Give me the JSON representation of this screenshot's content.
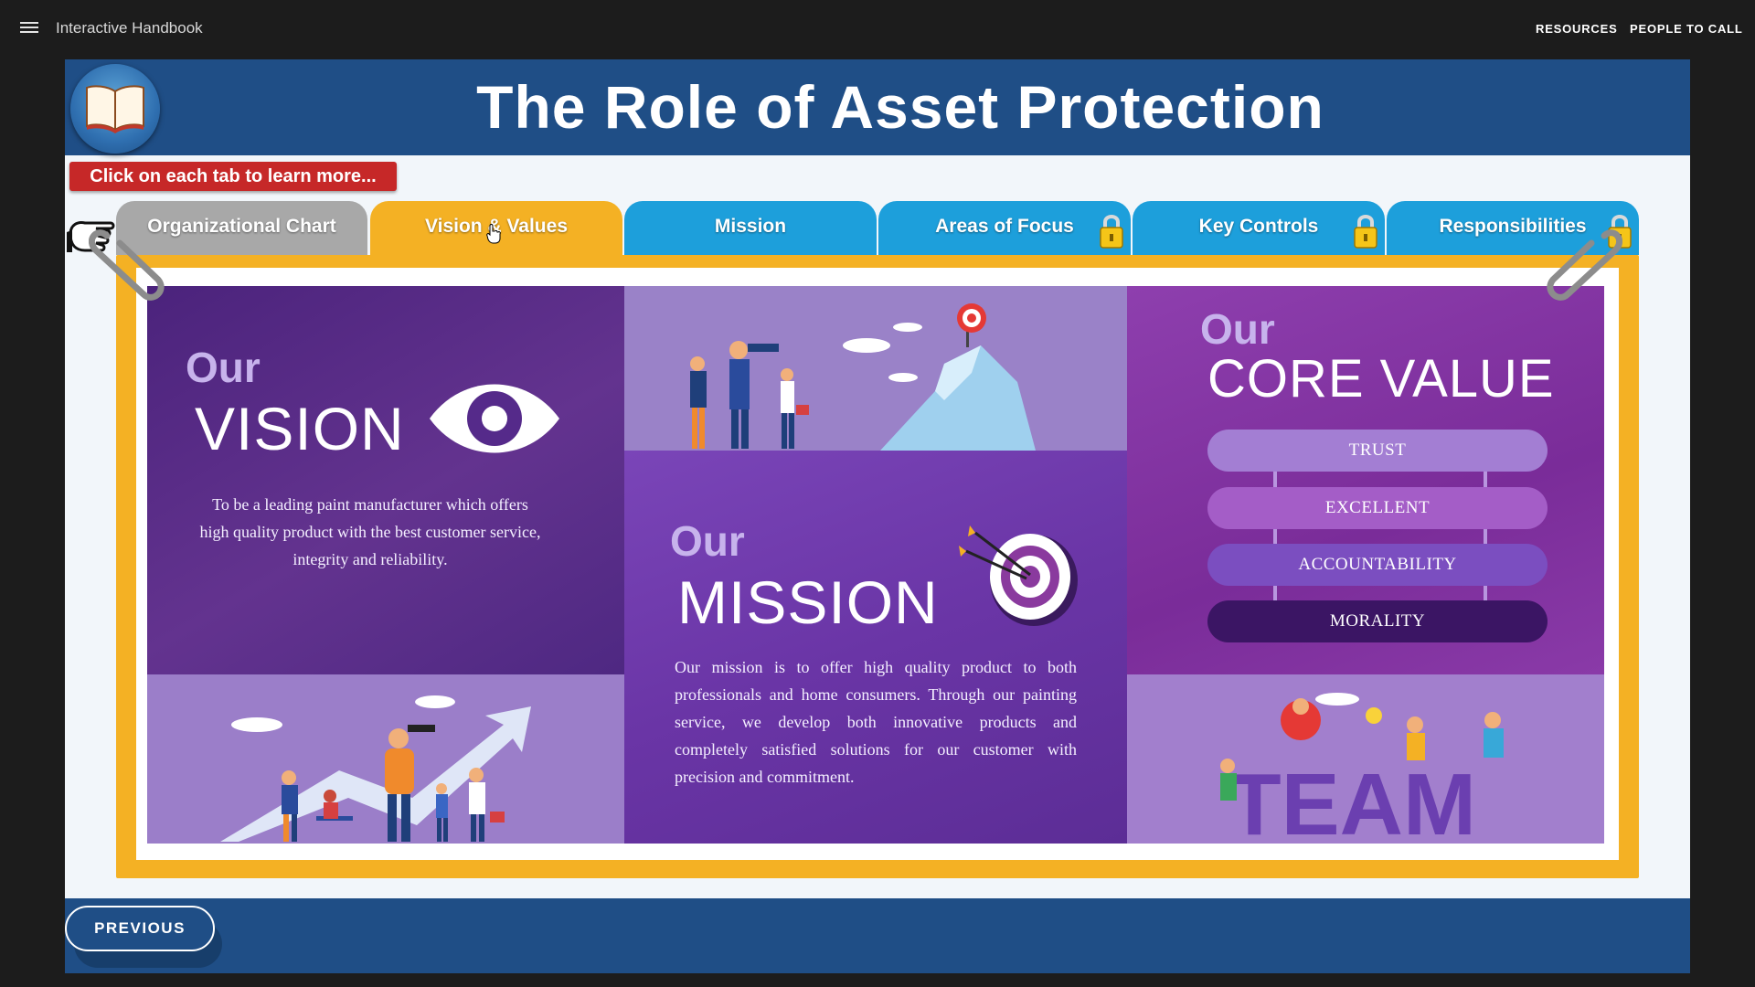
{
  "app": {
    "title": "Interactive Handbook",
    "links": {
      "resources": "RESOURCES",
      "people": "PEOPLE TO CALL"
    }
  },
  "slide": {
    "title": "The Role of Asset Protection",
    "hint": "Click on each tab to learn more...",
    "tabs": [
      {
        "label": "Organizational Chart",
        "state": "visited",
        "locked": false
      },
      {
        "label": "Vision & Values",
        "state": "active",
        "locked": false
      },
      {
        "label": "Mission",
        "state": "default",
        "locked": false
      },
      {
        "label": "Areas of Focus",
        "state": "default",
        "locked": true
      },
      {
        "label": "Key Controls",
        "state": "default",
        "locked": true
      },
      {
        "label": "Responsibilities",
        "state": "default",
        "locked": true
      }
    ]
  },
  "content": {
    "vision": {
      "our": "Our",
      "heading": "VISION",
      "text": "To be a leading paint manufacturer which offers high quality product with the best customer service, integrity and reliability."
    },
    "mission": {
      "our": "Our",
      "heading": "MISSION",
      "text": "Our mission is to offer high quality product to both professionals and home consumers. Through our painting service, we develop both innovative products and completely satisfied solutions for our customer with precision and commitment."
    },
    "core_value": {
      "our": "Our",
      "heading": "CORE VALUE",
      "values": [
        "TRUST",
        "EXCELLENT",
        "ACCOUNTABILITY",
        "MORALITY"
      ]
    },
    "team_word": "TEAM"
  },
  "footer": {
    "previous": "PREVIOUS"
  },
  "colors": {
    "title_band": "#1f4e86",
    "active_tab": "#f4b124",
    "tab_blue": "#1d9fdb",
    "visited_tab": "#a8a8a8",
    "hint_red": "#c62828",
    "purple_dark": "#552a8a"
  },
  "icons": [
    "menu-icon",
    "book-icon",
    "pointing-hand-icon",
    "lock-icon",
    "mouse-cursor-icon",
    "eye-icon",
    "target-icon",
    "paperclip-icon"
  ]
}
